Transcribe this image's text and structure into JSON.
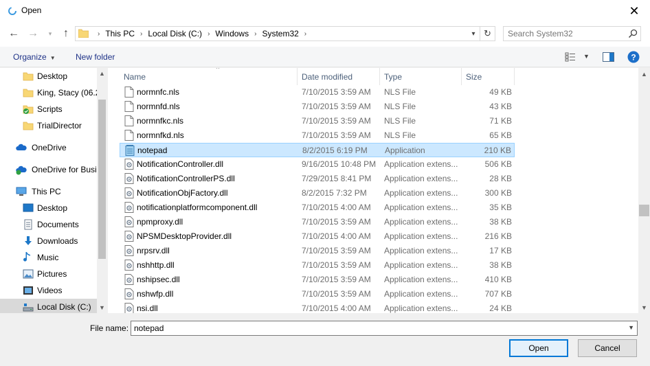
{
  "window": {
    "title": "Open"
  },
  "nav": {
    "breadcrumb": [
      "This PC",
      "Local Disk (C:)",
      "Windows",
      "System32"
    ],
    "search_placeholder": "Search System32"
  },
  "toolbar": {
    "organize": "Organize",
    "new_folder": "New folder"
  },
  "sidebar": {
    "items": [
      {
        "label": "Desktop",
        "icon": "folder-icon"
      },
      {
        "label": "King, Stacy (06.2",
        "icon": "folder-icon"
      },
      {
        "label": "Scripts",
        "icon": "synced-folder-icon"
      },
      {
        "label": "TrialDirector",
        "icon": "folder-icon"
      },
      {
        "label": "OneDrive",
        "icon": "cloud-icon"
      },
      {
        "label": "OneDrive for Busi",
        "icon": "cloud-sync-icon"
      },
      {
        "label": "This PC",
        "icon": "computer-icon"
      },
      {
        "label": "Desktop",
        "icon": "desktop-icon"
      },
      {
        "label": "Documents",
        "icon": "documents-icon"
      },
      {
        "label": "Downloads",
        "icon": "download-icon"
      },
      {
        "label": "Music",
        "icon": "music-icon"
      },
      {
        "label": "Pictures",
        "icon": "pictures-icon"
      },
      {
        "label": "Videos",
        "icon": "videos-icon"
      },
      {
        "label": "Local Disk (C:)",
        "icon": "drive-icon",
        "selected": true
      }
    ]
  },
  "columns": {
    "name": "Name",
    "date": "Date modified",
    "type": "Type",
    "size": "Size"
  },
  "files": [
    {
      "name": "normnfc.nls",
      "date": "7/10/2015 3:59 AM",
      "type": "NLS File",
      "size": "49 KB",
      "icon": "document-icon"
    },
    {
      "name": "normnfd.nls",
      "date": "7/10/2015 3:59 AM",
      "type": "NLS File",
      "size": "43 KB",
      "icon": "document-icon"
    },
    {
      "name": "normnfkc.nls",
      "date": "7/10/2015 3:59 AM",
      "type": "NLS File",
      "size": "71 KB",
      "icon": "document-icon"
    },
    {
      "name": "normnfkd.nls",
      "date": "7/10/2015 3:59 AM",
      "type": "NLS File",
      "size": "65 KB",
      "icon": "document-icon"
    },
    {
      "name": "notepad",
      "date": "8/2/2015 6:19 PM",
      "type": "Application",
      "size": "210 KB",
      "icon": "notepad-icon",
      "selected": true
    },
    {
      "name": "NotificationController.dll",
      "date": "9/16/2015 10:48 PM",
      "type": "Application extens...",
      "size": "506 KB",
      "icon": "dll-icon"
    },
    {
      "name": "NotificationControllerPS.dll",
      "date": "7/29/2015 8:41 PM",
      "type": "Application extens...",
      "size": "28 KB",
      "icon": "dll-icon"
    },
    {
      "name": "NotificationObjFactory.dll",
      "date": "8/2/2015 7:32 PM",
      "type": "Application extens...",
      "size": "300 KB",
      "icon": "dll-icon"
    },
    {
      "name": "notificationplatformcomponent.dll",
      "date": "7/10/2015 4:00 AM",
      "type": "Application extens...",
      "size": "35 KB",
      "icon": "dll-icon"
    },
    {
      "name": "npmproxy.dll",
      "date": "7/10/2015 3:59 AM",
      "type": "Application extens...",
      "size": "38 KB",
      "icon": "dll-icon"
    },
    {
      "name": "NPSMDesktopProvider.dll",
      "date": "7/10/2015 4:00 AM",
      "type": "Application extens...",
      "size": "216 KB",
      "icon": "dll-icon"
    },
    {
      "name": "nrpsrv.dll",
      "date": "7/10/2015 3:59 AM",
      "type": "Application extens...",
      "size": "17 KB",
      "icon": "dll-icon"
    },
    {
      "name": "nshhttp.dll",
      "date": "7/10/2015 3:59 AM",
      "type": "Application extens...",
      "size": "38 KB",
      "icon": "dll-icon"
    },
    {
      "name": "nshipsec.dll",
      "date": "7/10/2015 3:59 AM",
      "type": "Application extens...",
      "size": "410 KB",
      "icon": "dll-icon"
    },
    {
      "name": "nshwfp.dll",
      "date": "7/10/2015 3:59 AM",
      "type": "Application extens...",
      "size": "707 KB",
      "icon": "dll-icon"
    },
    {
      "name": "nsi.dll",
      "date": "7/10/2015 4:00 AM",
      "type": "Application extens...",
      "size": "24 KB",
      "icon": "dll-icon"
    }
  ],
  "footer": {
    "filename_label": "File name:",
    "filename_value": "notepad",
    "open_label": "Open",
    "cancel_label": "Cancel"
  },
  "colors": {
    "accent": "#0078d7",
    "selection": "#cce8ff",
    "link": "#1e3287"
  }
}
